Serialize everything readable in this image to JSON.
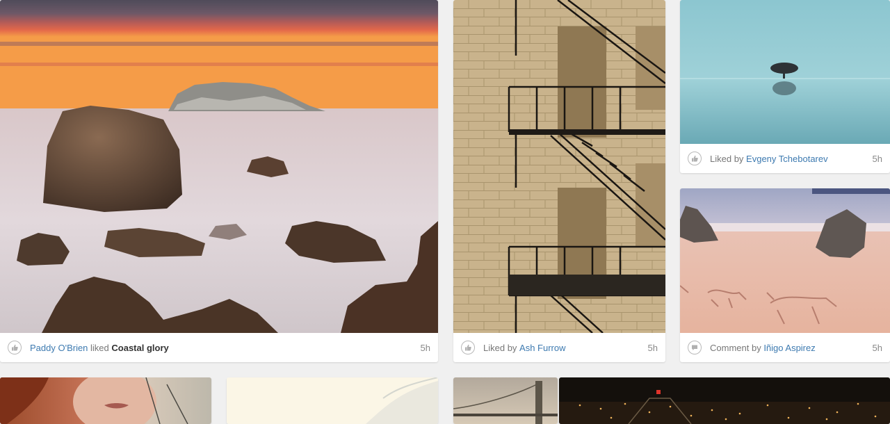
{
  "cards": [
    {
      "user": "Paddy O'Brien",
      "action": " liked ",
      "title": "Coastal glory",
      "time": "5h",
      "icon": "thumbs-up-icon"
    },
    {
      "prefix": "Liked by ",
      "user": "Ash Furrow",
      "time": "5h",
      "icon": "thumbs-up-icon"
    },
    {
      "prefix": "Liked by ",
      "user": "Evgeny Tchebotarev",
      "time": "5h",
      "icon": "thumbs-up-icon"
    },
    {
      "prefix": "Comment by ",
      "user": "Iñigo Aspirez",
      "time": "5h",
      "icon": "comment-icon"
    }
  ],
  "colors": {
    "link": "#3d7ab0",
    "background": "#f0f0f0",
    "card": "#ffffff"
  }
}
